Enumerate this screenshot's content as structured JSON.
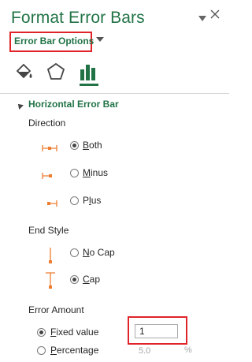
{
  "pane": {
    "title": "Format Error Bars",
    "dropdown_arrow_icon": "small-down-triangle",
    "close_icon": "close-x"
  },
  "options_dropdown": {
    "label": "Error Bar Options"
  },
  "tabs": [
    {
      "icon": "paint-bucket-icon",
      "name": "Fill & Line"
    },
    {
      "icon": "pentagon-icon",
      "name": "Effects"
    },
    {
      "icon": "bar-chart-icon",
      "name": "Error Bar Options",
      "selected": true
    }
  ],
  "section": {
    "title": "Horizontal Error Bar"
  },
  "direction": {
    "label": "Direction",
    "options": [
      {
        "label": "Both",
        "accel": "B",
        "rest": "oth",
        "checked": true,
        "icon": "error-bar-both-icon"
      },
      {
        "label": "Minus",
        "accel": "M",
        "rest": "inus",
        "checked": false,
        "icon": "error-bar-minus-icon"
      },
      {
        "label": "Plus",
        "accel": "l",
        "pre": "P",
        "rest": "us",
        "checked": false,
        "icon": "error-bar-plus-icon"
      }
    ]
  },
  "end_style": {
    "label": "End Style",
    "options": [
      {
        "label": "No Cap",
        "accel": "N",
        "rest": "o Cap",
        "checked": false,
        "icon": "error-bar-no-cap-icon"
      },
      {
        "label": "Cap",
        "accel": "C",
        "rest": "ap",
        "checked": true,
        "icon": "error-bar-cap-icon"
      }
    ]
  },
  "error_amount": {
    "label": "Error Amount",
    "fixed_value": {
      "label": "Fixed value",
      "accel": "F",
      "rest": "ixed value",
      "checked": true,
      "value": "1"
    },
    "percentage": {
      "label": "Percentage",
      "accel": "P",
      "rest": "ercentage",
      "checked": false,
      "value": "5.0",
      "unit": "%"
    }
  },
  "colors": {
    "accent_green": "#217346",
    "highlight_red": "#e0242a",
    "icon_orange": "#ed7d31"
  }
}
